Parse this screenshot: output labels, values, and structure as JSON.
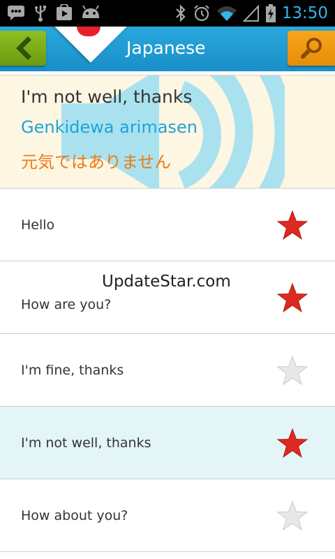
{
  "status_bar": {
    "time": "13:50",
    "icons": [
      "chat-icon",
      "usb-icon",
      "play-store-icon",
      "android-icon",
      "bluetooth-icon",
      "alarm-icon",
      "wifi-icon",
      "signal-icon",
      "battery-charging-icon"
    ]
  },
  "appbar": {
    "title": "Japanese",
    "back_icon": "chevron-left-icon",
    "search_icon": "search-icon",
    "colors": {
      "bar": "#1a8ec8",
      "back": "#7aaa16",
      "search": "#f29a10",
      "flag_red": "#e8202c"
    }
  },
  "current_phrase": {
    "english": "I'm not well, thanks",
    "romaji": "Genkidewa arimasen",
    "japanese": "元気ではありません",
    "icon": "speaker-icon"
  },
  "phrases": [
    {
      "label": "Hello",
      "favorite": true
    },
    {
      "label": "How are you?",
      "favorite": true
    },
    {
      "label": "I'm fine, thanks",
      "favorite": false
    },
    {
      "label": "I'm not well, thanks",
      "favorite": true,
      "selected": true
    },
    {
      "label": "How about you?",
      "favorite": false
    }
  ],
  "watermark": "UpdateStar.com"
}
